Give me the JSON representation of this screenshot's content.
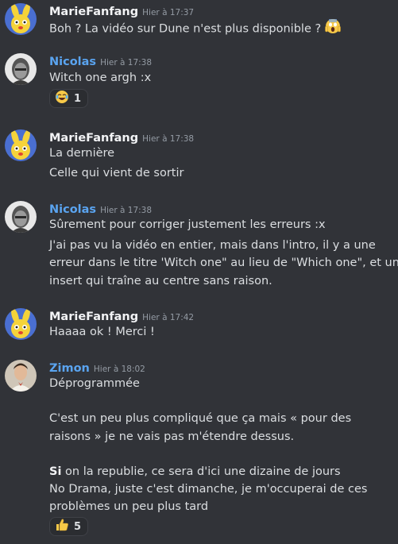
{
  "messages": [
    {
      "user": "MarieFanfang",
      "user_color": "#f2f3f5",
      "timestamp": "Hier à 17:37",
      "lines": [
        "Boh ? La vidéo sur Dune n'est plus disponible ?"
      ],
      "inline_emoji": "scream-emoji"
    },
    {
      "user": "Nicolas",
      "user_color": "#5aa4f0",
      "timestamp": "Hier à 17:38",
      "lines": [
        "Witch one argh :x"
      ],
      "reaction": {
        "emoji": "joy-emoji",
        "count": "1"
      }
    },
    {
      "user": "MarieFanfang",
      "user_color": "#f2f3f5",
      "timestamp": "Hier à 17:38",
      "lines": [
        "La dernière",
        "Celle qui vient de sortir"
      ]
    },
    {
      "user": "Nicolas",
      "user_color": "#5aa4f0",
      "timestamp": "Hier à 17:38",
      "lines": [
        "Sûrement pour corriger justement les erreurs :x",
        "J'ai pas vu la vidéo en entier, mais dans l'intro, il y a une",
        "erreur dans le titre 'Witch one\" au lieu de \"Which one\", et un",
        "insert qui traîne au centre sans raison."
      ]
    },
    {
      "user": "MarieFanfang",
      "user_color": "#f2f3f5",
      "timestamp": "Hier à 17:42",
      "lines": [
        "Haaaa ok ! Merci !"
      ]
    },
    {
      "user": "Zimon",
      "user_color": "#5aa4f0",
      "timestamp": "Hier à 18:02",
      "lines": [
        "Déprogrammée",
        "C'est un peu plus compliqué que ça mais « pour des",
        "raisons » je ne vais pas m'étendre dessus.",
        "Si",
        " on la republie, ce sera d'ici une dizaine de jours",
        "No Drama, juste c'est dimanche, je m'occuperai de ces",
        "problèmes un peu plus tard"
      ],
      "reaction": {
        "emoji": "thumbs-up-emoji",
        "count": "5"
      }
    }
  ]
}
